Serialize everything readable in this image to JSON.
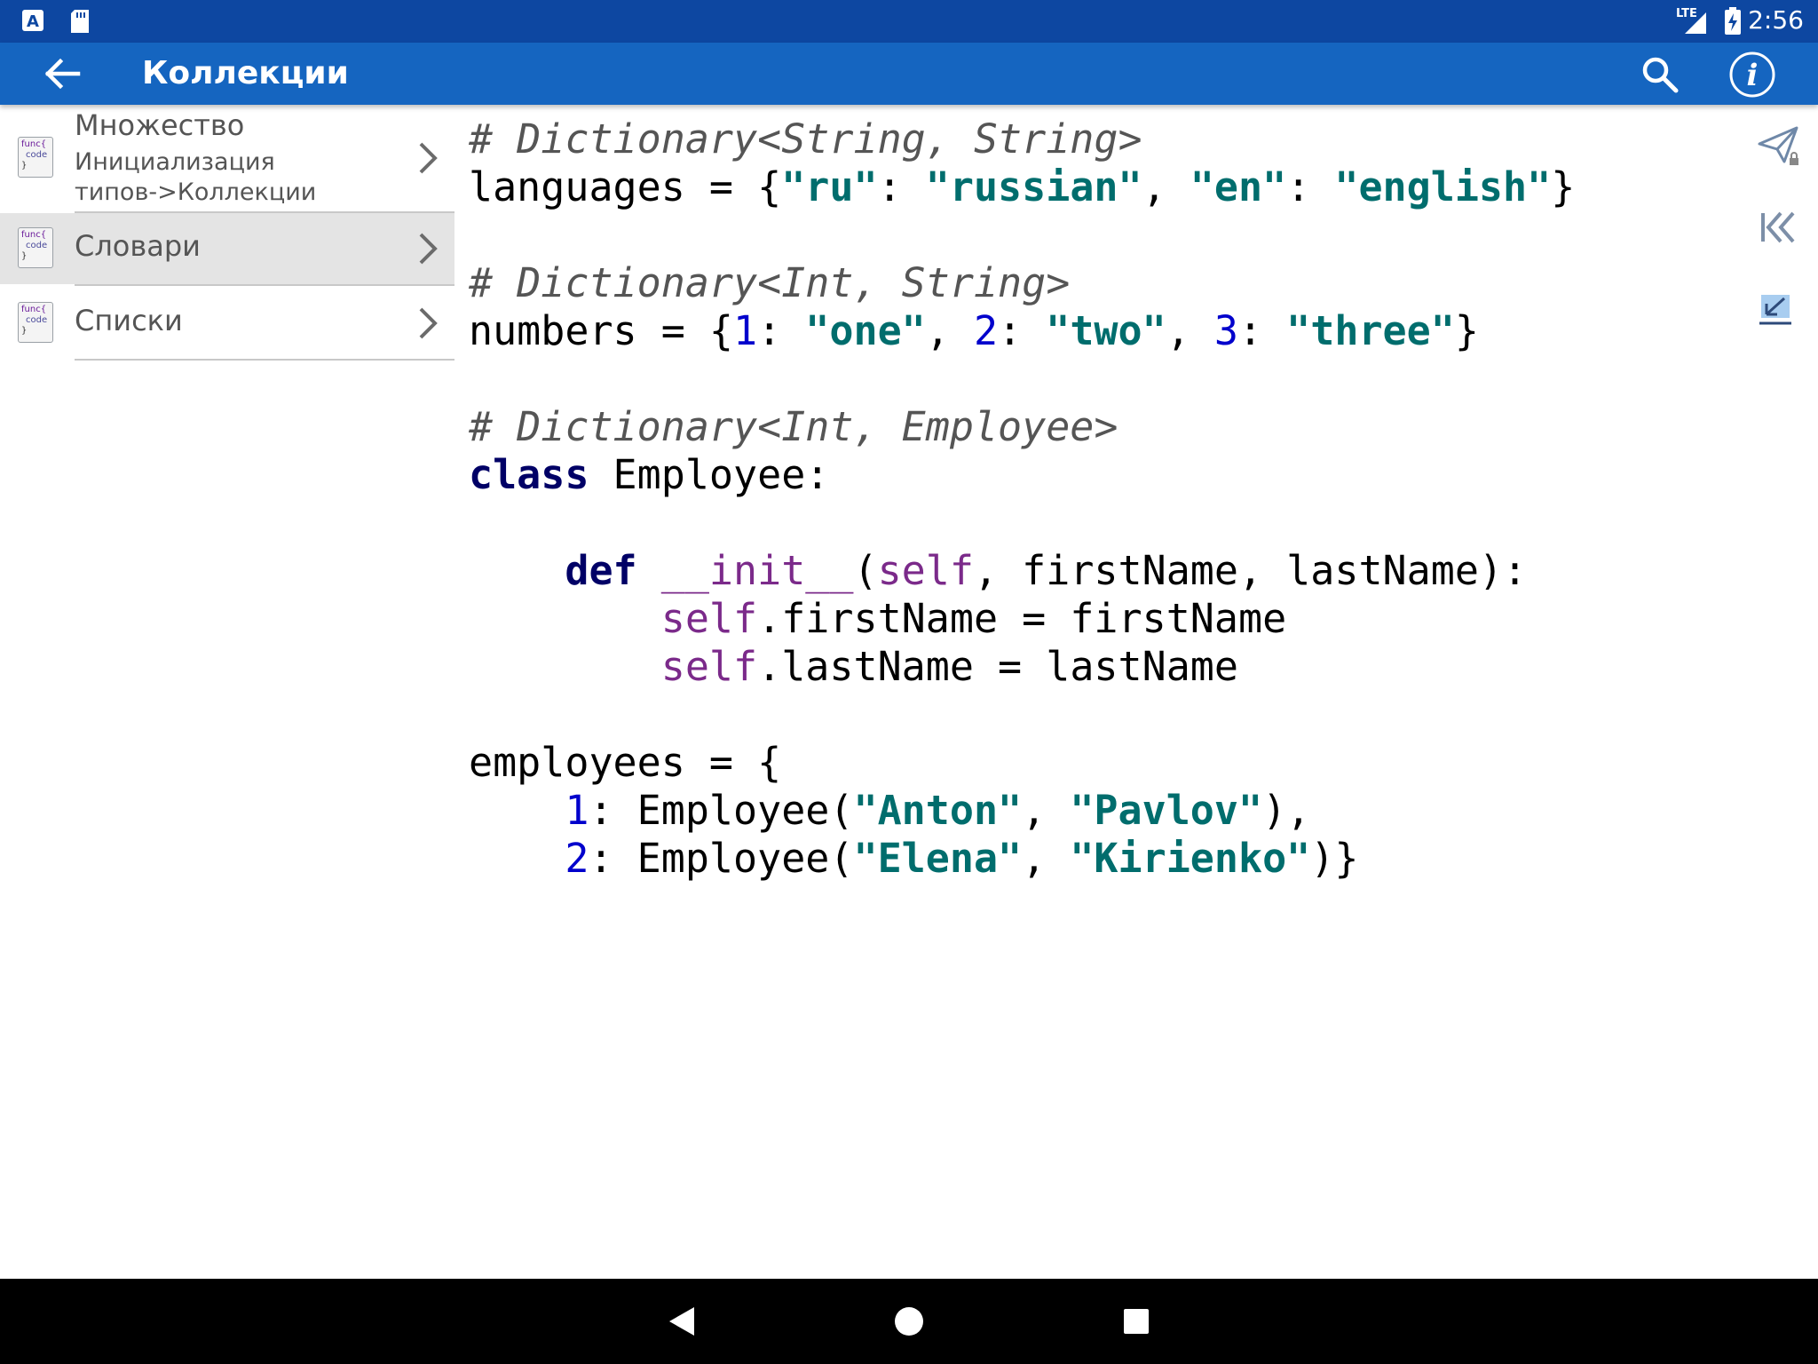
{
  "status_bar": {
    "time": "2:56",
    "network_label": "LTE",
    "icons": [
      "app-notification-icon",
      "sd-card-icon",
      "signal-icon",
      "battery-charging-icon"
    ]
  },
  "app_bar": {
    "title": "Коллекции",
    "icons": [
      "back-arrow-icon",
      "search-icon",
      "info-icon"
    ]
  },
  "sidebar": {
    "items": [
      {
        "title": "Множество",
        "subtitle_line1": "Инициализация",
        "subtitle_line2": "типов->Коллекции",
        "icon_text": [
          "func{",
          "code",
          "}"
        ],
        "selected": false
      },
      {
        "title": "Словари",
        "icon_text": [
          "func{",
          "code",
          "}"
        ],
        "selected": true
      },
      {
        "title": "Списки",
        "icon_text": [
          "func{",
          "code",
          "}"
        ],
        "selected": false
      }
    ]
  },
  "code": {
    "l1": "# Dictionary<String, String>",
    "l2": {
      "a": "languages = {",
      "b": "\"ru\"",
      "c": ": ",
      "d": "\"russian\"",
      "e": ", ",
      "f": "\"en\"",
      "g": ": ",
      "h": "\"english\"",
      "i": "}"
    },
    "l4": "# Dictionary<Int, String>",
    "l5": {
      "a": "numbers = {",
      "b": "1",
      "c": ": ",
      "d": "\"one\"",
      "e": ", ",
      "f": "2",
      "g": ": ",
      "h": "\"two\"",
      "i": ", ",
      "j": "3",
      "k": ": ",
      "l": "\"three\"",
      "m": "}"
    },
    "l7": "# Dictionary<Int, Employee>",
    "l8": {
      "a": "class",
      "b": " Employee:"
    },
    "l10": {
      "indent": "    ",
      "a": "def",
      "b": " ",
      "c": "__init__",
      "d": "(",
      "e": "self",
      "f": ", firstName, lastName):"
    },
    "l11": {
      "indent": "        ",
      "a": "self",
      "b": ".firstName = firstName"
    },
    "l12": {
      "indent": "        ",
      "a": "self",
      "b": ".lastName = lastName"
    },
    "l14": "employees = {",
    "l15": {
      "indent": "    ",
      "a": "1",
      "b": ": Employee(",
      "c": "\"Anton\"",
      "d": ", ",
      "e": "\"Pavlov\"",
      "f": "),"
    },
    "l16": {
      "indent": "    ",
      "a": "2",
      "b": ": Employee(",
      "c": "\"Elena\"",
      "d": ", ",
      "e": "\"Kirienko\"",
      "f": ")}"
    }
  },
  "right_toolbar": {
    "icons": [
      "send-locked-icon",
      "collapse-left-icon",
      "minimize-icon"
    ]
  },
  "nav_bar": {
    "icons": [
      "nav-back-icon",
      "nav-home-icon",
      "nav-recents-icon"
    ]
  },
  "colors": {
    "status_bar": "#0d47a1",
    "app_bar": "#1565c0",
    "string": "#006d6d",
    "number": "#0000cc",
    "keyword": "#000066",
    "self": "#7b2a8a",
    "comment": "#555555"
  }
}
